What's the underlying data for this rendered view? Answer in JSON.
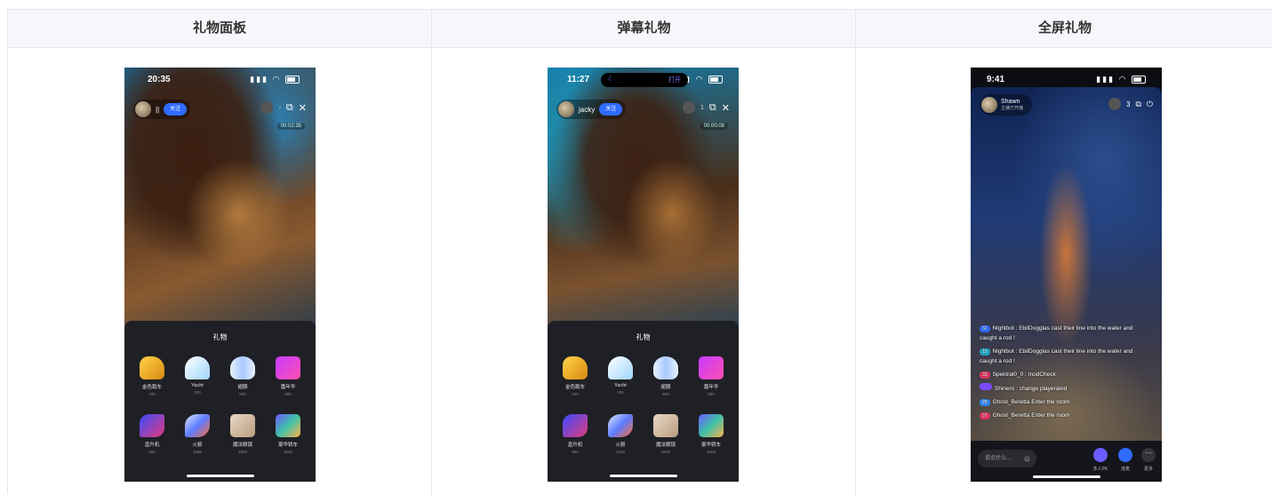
{
  "headers": [
    "礼物面板",
    "弹幕礼物",
    "全屏礼物"
  ],
  "phone1": {
    "time": "20:35",
    "host": "||",
    "follow": "关注",
    "net": "00:02:35",
    "panel_title": "礼物",
    "gifts": [
      {
        "name": "金色跑车",
        "price": "100"
      },
      {
        "name": "Yacht",
        "price": "200"
      },
      {
        "name": "翅膀",
        "price": "500"
      },
      {
        "name": "嘉年华",
        "price": "800"
      },
      {
        "name": "直升机",
        "price": "900"
      },
      {
        "name": "火箭",
        "price": "1000"
      },
      {
        "name": "魔法眼镜",
        "price": "2000"
      },
      {
        "name": "豪华轿车",
        "price": "3000"
      }
    ]
  },
  "phone2": {
    "time": "11:27",
    "island_open": "打开",
    "host": "jacky",
    "follow": "关注",
    "count": "1",
    "net": "00:00:08",
    "panel_title": "礼物",
    "gifts": [
      {
        "name": "金色跑车",
        "price": "100"
      },
      {
        "name": "Yacht",
        "price": "200"
      },
      {
        "name": "翅膀",
        "price": "500"
      },
      {
        "name": "嘉年华",
        "price": "800"
      },
      {
        "name": "直升机",
        "price": "900"
      },
      {
        "name": "火箭",
        "price": "1000"
      },
      {
        "name": "魔法眼镜",
        "price": "2000"
      },
      {
        "name": "豪华轿车",
        "price": "3000"
      }
    ]
  },
  "phone3": {
    "time": "9:41",
    "host": "Shawn",
    "host_sub": "主播已开播",
    "count": "3",
    "messages": [
      {
        "lv": "32",
        "text": "Nightbot : EbilDogglas cast their line into the water and caught a rod !"
      },
      {
        "lv": "10",
        "text": "Nightbot : EbilDogglas cast their line into the water and caught a rod !"
      },
      {
        "lv": "33",
        "text": "Spektral0_0 : modCheck"
      },
      {
        "lv": "",
        "text": "Shinero : change playerated"
      },
      {
        "lv": "28",
        "text": "Ghost_Beretta Enter the room"
      },
      {
        "lv": "37",
        "text": "Ghost_Beretta Enter the room"
      }
    ],
    "input_placeholder": "说点什么...",
    "btn1": "多人PK",
    "btn2": "连麦",
    "btn3": "更多"
  }
}
